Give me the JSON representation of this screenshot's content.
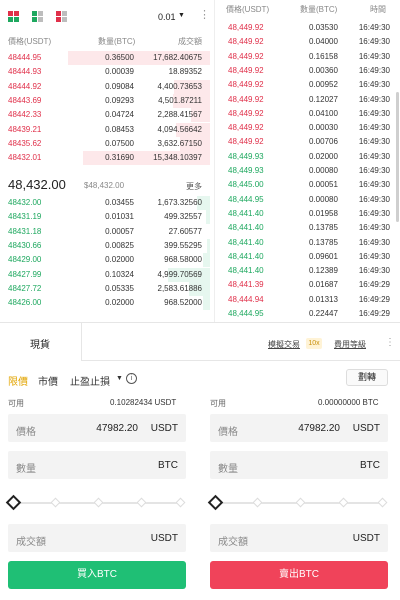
{
  "toolbar": {
    "modes": [
      "both-book-icon",
      "bids-book-icon",
      "asks-book-icon"
    ],
    "precision": "0.01",
    "more_icon": "⋮"
  },
  "orderbook": {
    "headers": {
      "price": "價格(USDT)",
      "qty": "數量(BTC)",
      "total": "成交額"
    },
    "asks": [
      {
        "price": "48444.95",
        "qty": "0.36500",
        "total": "17,682.40675",
        "depth": 0.95
      },
      {
        "price": "48444.93",
        "qty": "0.00039",
        "total": "18.89352",
        "depth": 0.0
      },
      {
        "price": "48444.92",
        "qty": "0.09084",
        "total": "4,400.73653",
        "depth": 0.24
      },
      {
        "price": "48443.69",
        "qty": "0.09293",
        "total": "4,501.87211",
        "depth": 0.25
      },
      {
        "price": "48442.33",
        "qty": "0.04724",
        "total": "2,288.41567",
        "depth": 0.13
      },
      {
        "price": "48439.21",
        "qty": "0.08453",
        "total": "4,094.56642",
        "depth": 0.23
      },
      {
        "price": "48435.62",
        "qty": "0.07500",
        "total": "3,632.67150",
        "depth": 0.2
      },
      {
        "price": "48432.01",
        "qty": "0.31690",
        "total": "15,348.10397",
        "depth": 0.85
      }
    ],
    "last": {
      "price": "48,432.00",
      "fiat": "$48,432.00",
      "more": "更多"
    },
    "bids": [
      {
        "price": "48432.00",
        "qty": "0.03455",
        "total": "1,673.32560",
        "depth": 0.09
      },
      {
        "price": "48431.19",
        "qty": "0.01031",
        "total": "499.32557",
        "depth": 0.03
      },
      {
        "price": "48431.18",
        "qty": "0.00057",
        "total": "27.60577",
        "depth": 0.0
      },
      {
        "price": "48430.66",
        "qty": "0.00825",
        "total": "399.55295",
        "depth": 0.02
      },
      {
        "price": "48429.00",
        "qty": "0.02000",
        "total": "968.58000",
        "depth": 0.05
      },
      {
        "price": "48427.99",
        "qty": "0.10324",
        "total": "4,999.70569",
        "depth": 0.28
      },
      {
        "price": "48427.72",
        "qty": "0.05335",
        "total": "2,583.61886",
        "depth": 0.14
      },
      {
        "price": "48426.00",
        "qty": "0.02000",
        "total": "968.52000",
        "depth": 0.05
      }
    ]
  },
  "trades": {
    "headers": {
      "price": "價格(USDT)",
      "qty": "數量(BTC)",
      "time": "時間"
    },
    "rows": [
      {
        "price": "48,449.92",
        "qty": "0.03530",
        "time": "16:49:30",
        "side": "red"
      },
      {
        "price": "48,449.92",
        "qty": "0.04000",
        "time": "16:49:30",
        "side": "red"
      },
      {
        "price": "48,449.92",
        "qty": "0.16158",
        "time": "16:49:30",
        "side": "red"
      },
      {
        "price": "48,449.92",
        "qty": "0.00360",
        "time": "16:49:30",
        "side": "red"
      },
      {
        "price": "48,449.92",
        "qty": "0.00952",
        "time": "16:49:30",
        "side": "red"
      },
      {
        "price": "48,449.92",
        "qty": "0.12027",
        "time": "16:49:30",
        "side": "red"
      },
      {
        "price": "48,449.92",
        "qty": "0.04100",
        "time": "16:49:30",
        "side": "red"
      },
      {
        "price": "48,449.92",
        "qty": "0.00030",
        "time": "16:49:30",
        "side": "red"
      },
      {
        "price": "48,449.92",
        "qty": "0.00706",
        "time": "16:49:30",
        "side": "red"
      },
      {
        "price": "48,449.93",
        "qty": "0.02000",
        "time": "16:49:30",
        "side": "green"
      },
      {
        "price": "48,449.93",
        "qty": "0.00080",
        "time": "16:49:30",
        "side": "green"
      },
      {
        "price": "48,445.00",
        "qty": "0.00051",
        "time": "16:49:30",
        "side": "green"
      },
      {
        "price": "48,444.95",
        "qty": "0.00080",
        "time": "16:49:30",
        "side": "green"
      },
      {
        "price": "48,441.40",
        "qty": "0.01958",
        "time": "16:49:30",
        "side": "green"
      },
      {
        "price": "48,441.40",
        "qty": "0.13785",
        "time": "16:49:30",
        "side": "green"
      },
      {
        "price": "48,441.40",
        "qty": "0.13785",
        "time": "16:49:30",
        "side": "green"
      },
      {
        "price": "48,441.40",
        "qty": "0.09601",
        "time": "16:49:30",
        "side": "green"
      },
      {
        "price": "48,441.40",
        "qty": "0.12389",
        "time": "16:49:30",
        "side": "green"
      },
      {
        "price": "48,441.39",
        "qty": "0.01687",
        "time": "16:49:29",
        "side": "red"
      },
      {
        "price": "48,444.94",
        "qty": "0.01313",
        "time": "16:49:29",
        "side": "red"
      },
      {
        "price": "48,444.95",
        "qty": "0.22447",
        "time": "16:49:29",
        "side": "green"
      }
    ]
  },
  "tabs": {
    "spot": "現貨",
    "mock": "模擬交易",
    "leverage": "10x",
    "fee": "費用等級",
    "more_icon": "⋮"
  },
  "order_types": {
    "limit": "限價",
    "market": "市價",
    "stop_limit": "止盈止損",
    "info_icon": "i",
    "transfer": "劃轉"
  },
  "buy_form": {
    "avail_label": "可用",
    "avail_value": "0.10282434 USDT",
    "price_label": "價格",
    "price_value": "47982.20",
    "price_unit": "USDT",
    "qty_label": "數量",
    "qty_unit": "BTC",
    "total_label": "成交額",
    "total_unit": "USDT",
    "slider_percent": 0,
    "button": "買入BTC"
  },
  "sell_form": {
    "avail_label": "可用",
    "avail_value": "0.00000000 BTC",
    "price_label": "價格",
    "price_value": "47982.20",
    "price_unit": "USDT",
    "qty_label": "數量",
    "qty_unit": "BTC",
    "total_label": "成交額",
    "total_unit": "USDT",
    "slider_percent": 0,
    "button": "賣出BTC"
  },
  "colors": {
    "ask": "#e0304a",
    "bid": "#1ea85f",
    "ask_bg": "#fde8ea",
    "bid_bg": "#e6f7ef",
    "accent": "#e2a400",
    "buy_button": "#1fbf75",
    "sell_button": "#f0435a"
  }
}
